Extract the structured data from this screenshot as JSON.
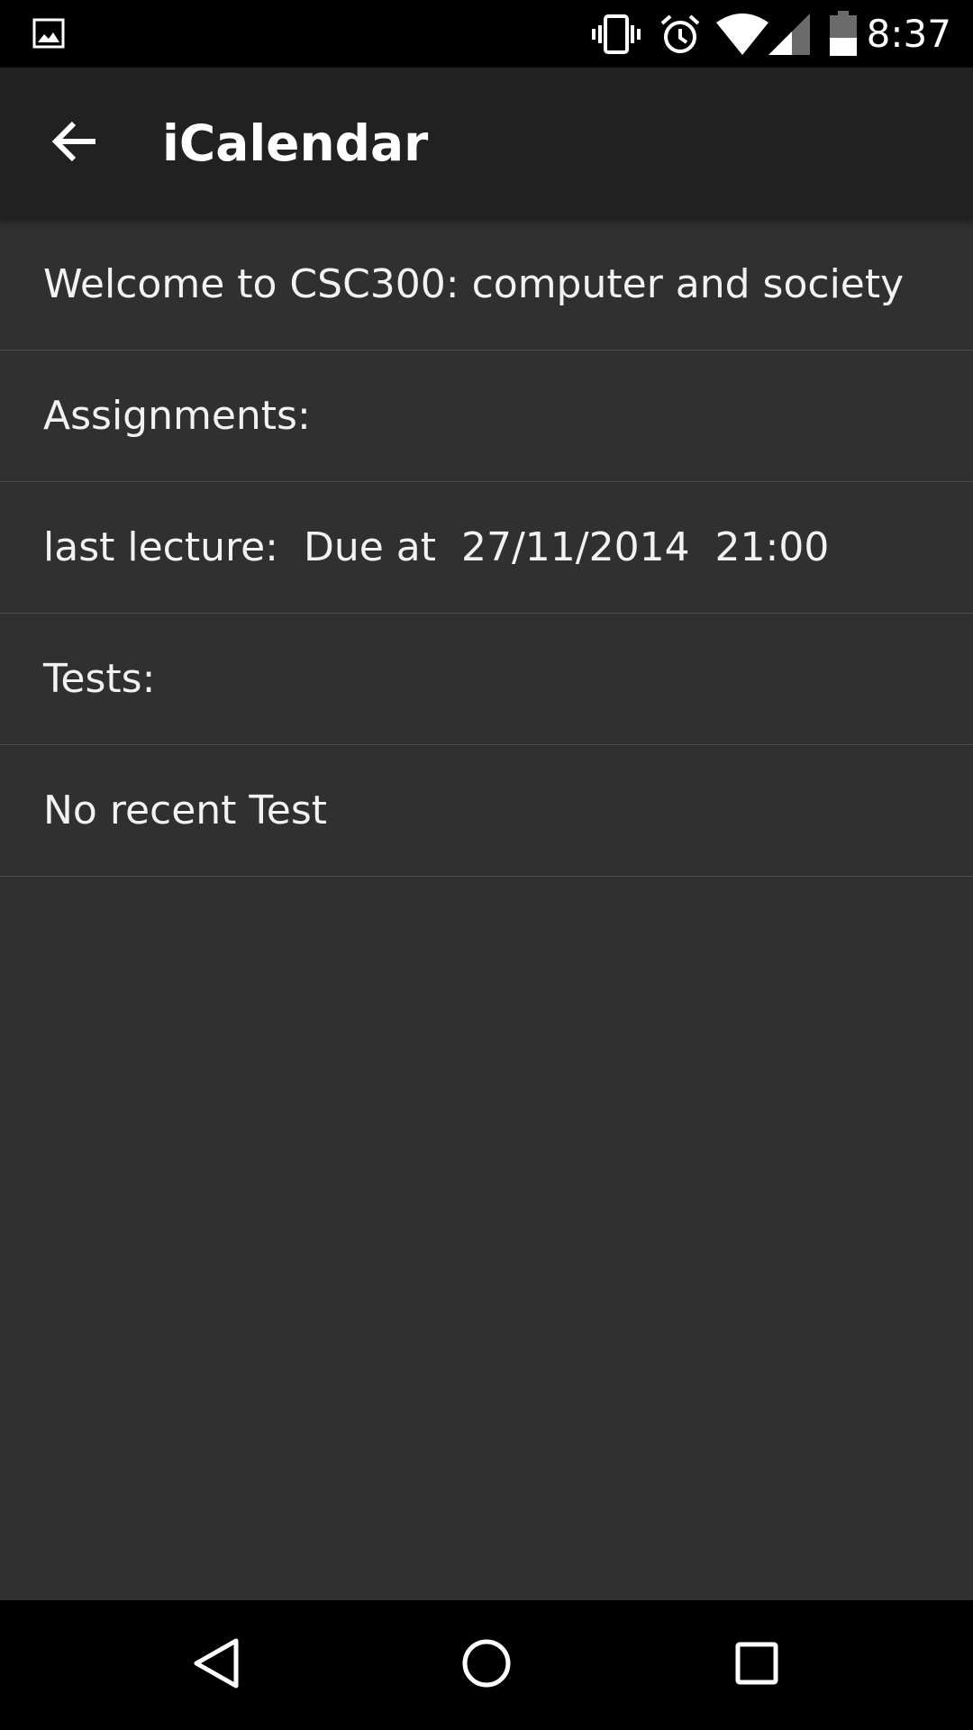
{
  "status_bar": {
    "time": "8:37",
    "icons": [
      "gallery-icon",
      "vibrate-icon",
      "alarm-icon",
      "wifi-icon",
      "signal-icon",
      "battery-icon"
    ]
  },
  "app_bar": {
    "title": "iCalendar",
    "back_icon": "arrow-back-icon"
  },
  "list": {
    "items": [
      {
        "text": "Welcome to CSC300: computer and society"
      },
      {
        "text": "Assignments:"
      },
      {
        "text": "last lecture:  Due at  27/11/2014  21:00"
      },
      {
        "text": "Tests:"
      },
      {
        "text": "No recent Test"
      }
    ]
  },
  "nav_bar": {
    "buttons": [
      "back-triangle-icon",
      "home-circle-icon",
      "recents-square-icon"
    ]
  },
  "colors": {
    "background": "#303030",
    "app_bar": "#212121",
    "status_bar": "#000000",
    "divider": "#4c4c4c",
    "text": "#f2f2f2"
  }
}
